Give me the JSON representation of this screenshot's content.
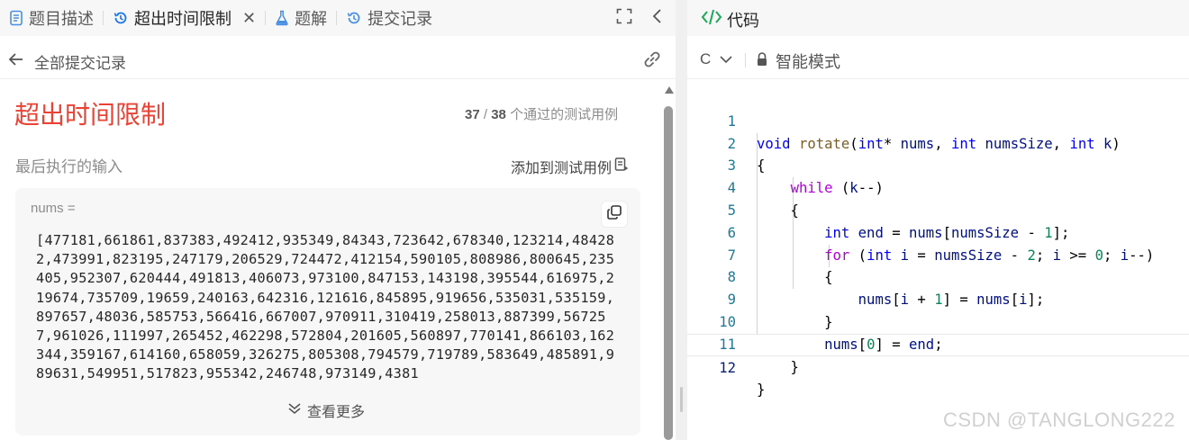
{
  "tabs": [
    {
      "label": "题目描述",
      "icon": "description-icon"
    },
    {
      "label": "超出时间限制",
      "icon": "history-icon",
      "active": true
    },
    {
      "label": "题解",
      "icon": "flask-icon"
    },
    {
      "label": "提交记录",
      "icon": "history-icon"
    }
  ],
  "subbar": {
    "back_label": "全部提交记录"
  },
  "result": {
    "status": "超出时间限制",
    "passed": "37",
    "total": "38",
    "passed_suffix": "个通过的测试用例",
    "last_input_label": "最后执行的输入",
    "add_testcase_label": "添加到测试用例"
  },
  "input": {
    "name_label": "nums =",
    "value": "[477181,661861,837383,492412,935349,84343,723642,678340,123214,484282,473991,823195,247179,206529,724472,412154,590105,808986,800645,235405,952307,620444,491813,406073,973100,847153,143198,395544,616975,219674,735709,19659,240163,642316,121616,845895,919656,535031,535159,897657,48036,585753,566416,667007,970911,310419,258013,887399,567257,961026,111997,265452,462298,572804,201605,560897,770141,866103,162344,359167,614160,658059,326275,805308,794579,719789,583649,485891,989631,549951,517823,955342,246748,973149,4381",
    "expand_label": "查看更多"
  },
  "code_panel": {
    "title": "代码",
    "language": "C",
    "mode": "智能模式",
    "line_numbers": [
      "1",
      "2",
      "3",
      "4",
      "5",
      "6",
      "7",
      "8",
      "9",
      "10",
      "11",
      "12"
    ],
    "lines": [
      "void rotate(int* nums, int numsSize, int k)",
      "{",
      "    while (k--)",
      "    {",
      "        int end = nums[numsSize - 1];",
      "        for (int i = numsSize - 2; i >= 0; i--)",
      "        {",
      "            nums[i + 1] = nums[i];",
      "        }",
      "        nums[0] = end;",
      "    }",
      "}"
    ],
    "current_line": 12
  },
  "watermark": "CSDN @TANGLONG222",
  "colors": {
    "status_red": "#ea4335",
    "keyword_blue": "#0000ff",
    "control_purple": "#af00db",
    "function_brown": "#795e26",
    "variable_navy": "#001080",
    "number_green": "#098658",
    "line_number": "#237893",
    "code_icon_green": "#1aaa55"
  }
}
